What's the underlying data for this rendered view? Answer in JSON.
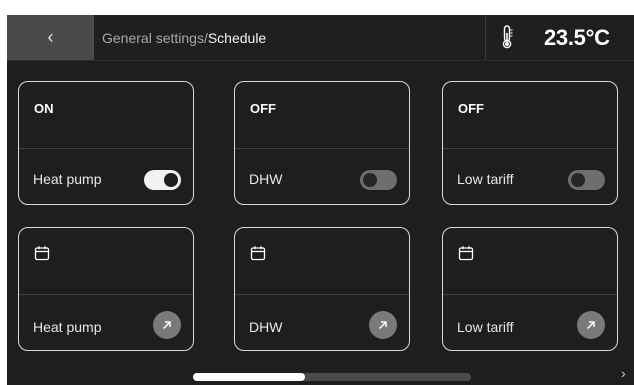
{
  "header": {
    "back_icon": "chevron-left-icon",
    "back_glyph": "‹",
    "breadcrumb_parent": "General settings",
    "breadcrumb_separator": "/",
    "breadcrumb_current": "Schedule",
    "thermometer_icon": "thermometer-icon",
    "temperature": "23.5°C"
  },
  "toggle_cards": [
    {
      "state": "ON",
      "label": "Heat pump",
      "enabled": true
    },
    {
      "state": "OFF",
      "label": "DHW",
      "enabled": false
    },
    {
      "state": "OFF",
      "label": "Low tariff",
      "enabled": false
    }
  ],
  "schedule_cards": [
    {
      "icon": "calendar-icon",
      "label": "Heat pump",
      "action_icon": "arrow-up-right-icon"
    },
    {
      "icon": "calendar-icon",
      "label": "DHW",
      "action_icon": "arrow-up-right-icon"
    },
    {
      "icon": "calendar-icon",
      "label": "Low tariff",
      "action_icon": "arrow-up-right-icon"
    }
  ],
  "pager": {
    "next_glyph": "›"
  },
  "colors": {
    "background": "#1e1e1e",
    "back_button": "#4a4a4a",
    "card_border": "#d9d9d9",
    "toggle_on": "#f2f2f2",
    "toggle_off": "#6e6e6e",
    "action_button": "#7a7a7a"
  }
}
